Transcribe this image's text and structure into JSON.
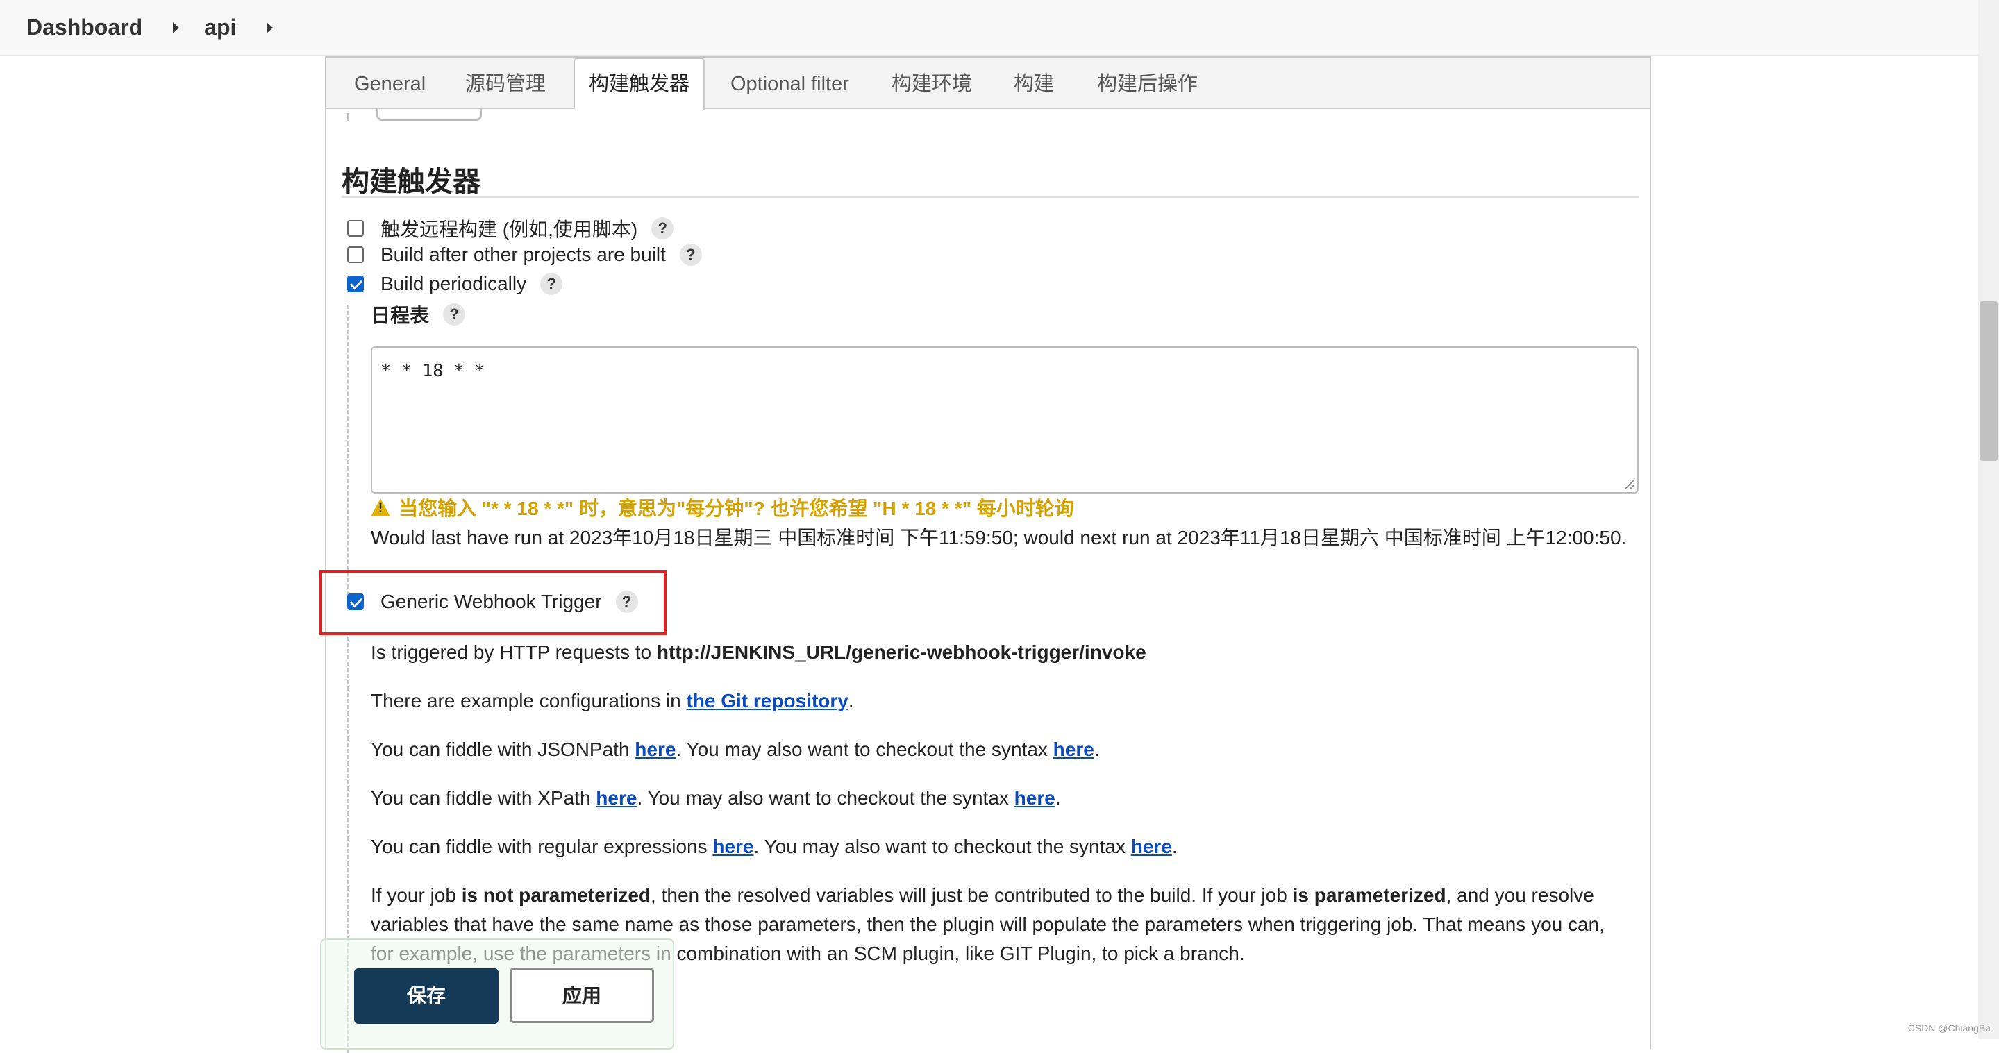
{
  "breadcrumb": {
    "items": [
      "Dashboard",
      "api"
    ]
  },
  "tabs": [
    {
      "label": "General",
      "active": false
    },
    {
      "label": "源码管理",
      "active": false
    },
    {
      "label": "构建触发器",
      "active": true
    },
    {
      "label": "Optional filter",
      "active": false
    },
    {
      "label": "构建环境",
      "active": false
    },
    {
      "label": "构建",
      "active": false
    },
    {
      "label": "构建后操作",
      "active": false
    }
  ],
  "section": {
    "title": "构建触发器"
  },
  "triggers": [
    {
      "label": "触发远程构建 (例如,使用脚本)",
      "checked": false
    },
    {
      "label": "Build after other projects are built",
      "checked": false
    },
    {
      "label": "Build periodically",
      "checked": true
    },
    {
      "label": "Generic Webhook Trigger",
      "checked": true
    }
  ],
  "schedule": {
    "label": "日程表",
    "value": "* * 18 * *",
    "warning": "当您输入 \"* * 18 * *\" 时，意思为\"每分钟\"? 也许您希望 \"H * 18 * *\" 每小时轮询",
    "next_run": "Would last have run at 2023年10月18日星期三 中国标准时间 下午11:59:50; would next run at 2023年11月18日星期六 中国标准时间 上午12:00:50."
  },
  "webhook": {
    "p1_text": "Is triggered by HTTP requests to ",
    "p1_url": "http://JENKINS_URL/generic-webhook-trigger/invoke",
    "p2_text": "There are example configurations in ",
    "p2_link": "the Git repository",
    "p2_end": ".",
    "p3_text": "You can fiddle with JSONPath ",
    "p3_link1": "here",
    "p3_mid": ". You may also want to checkout the syntax ",
    "p3_link2": "here",
    "p3_end": ".",
    "p4_text": "You can fiddle with XPath ",
    "p4_link1": "here",
    "p4_mid": ". You may also want to checkout the syntax ",
    "p4_link2": "here",
    "p4_end": ".",
    "p5_text": "You can fiddle with regular expressions ",
    "p5_link1": "here",
    "p5_mid": ". You may also want to checkout the syntax ",
    "p5_link2": "here",
    "p5_end": ".",
    "p6_a": "If your job ",
    "p6_b": "is not parameterized",
    "p6_c": ", then the resolved variables will just be contributed to the build. If your job ",
    "p6_d": "is parameterized",
    "p6_e": ", and you resolve variables that have the same name as those parameters, then the plugin will populate the parameters when triggering job. That means you can, for example, use the parameters in combination with an SCM plugin, like GIT Plugin, to pick a branch."
  },
  "buttons": {
    "save": "保存",
    "apply": "应用"
  },
  "help_glyph": "?",
  "watermark": "CSDN @ChiangBa"
}
